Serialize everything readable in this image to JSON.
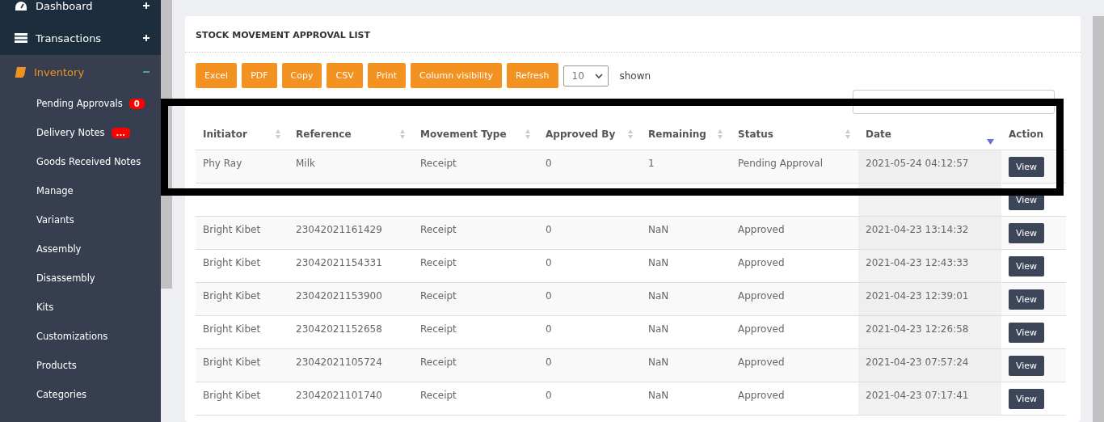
{
  "sidebar": {
    "items": [
      {
        "label": "Dashboard",
        "expanded": false,
        "selected": false
      },
      {
        "label": "Transactions",
        "expanded": false,
        "selected": false
      },
      {
        "label": "Inventory",
        "expanded": true,
        "selected": true,
        "children": [
          {
            "label": "Pending Approvals",
            "badge": "0"
          },
          {
            "label": "Delivery Notes",
            "badge": "..."
          },
          {
            "label": "Goods Received Notes"
          },
          {
            "label": "Manage"
          },
          {
            "label": "Variants"
          },
          {
            "label": "Assembly"
          },
          {
            "label": "Disassembly"
          },
          {
            "label": "Kits"
          },
          {
            "label": "Customizations"
          },
          {
            "label": "Products"
          },
          {
            "label": "Categories"
          }
        ]
      }
    ]
  },
  "card": {
    "title": "STOCK MOVEMENT APPROVAL LIST",
    "buttons": [
      "Excel",
      "PDF",
      "Copy",
      "CSV",
      "Print",
      "Column visibility",
      "Refresh"
    ],
    "page_size": "10",
    "page_size_suffix": "shown",
    "table": {
      "columns": [
        {
          "label": "Initiator",
          "sortable": true,
          "sorted": false
        },
        {
          "label": "Reference",
          "sortable": true,
          "sorted": false
        },
        {
          "label": "Movement Type",
          "sortable": true,
          "sorted": false
        },
        {
          "label": "Approved By",
          "sortable": true,
          "sorted": false
        },
        {
          "label": "Remaining",
          "sortable": true,
          "sorted": false
        },
        {
          "label": "Status",
          "sortable": true,
          "sorted": false
        },
        {
          "label": "Date",
          "sortable": true,
          "sorted": true
        },
        {
          "label": "Action",
          "sortable": false
        }
      ],
      "rows": [
        {
          "cells": [
            "Phy Ray",
            "Milk",
            "Receipt",
            "0",
            "1",
            "Pending Approval",
            "2021-05-24 04:12:57"
          ],
          "action": "View"
        },
        {
          "action": "View"
        },
        {
          "cells": [
            "Bright Kibet",
            "23042021161429",
            "Receipt",
            "0",
            "NaN",
            "Approved",
            "2021-04-23 13:14:32"
          ],
          "action": "View"
        },
        {
          "cells": [
            "Bright Kibet",
            "23042021154331",
            "Receipt",
            "0",
            "NaN",
            "Approved",
            "2021-04-23 12:43:33"
          ],
          "action": "View"
        },
        {
          "cells": [
            "Bright Kibet",
            "23042021153900",
            "Receipt",
            "0",
            "NaN",
            "Approved",
            "2021-04-23 12:39:01"
          ],
          "action": "View"
        },
        {
          "cells": [
            "Bright Kibet",
            "23042021152658",
            "Receipt",
            "0",
            "NaN",
            "Approved",
            "2021-04-23 12:26:58"
          ],
          "action": "View"
        },
        {
          "cells": [
            "Bright Kibet",
            "23042021105724",
            "Receipt",
            "0",
            "NaN",
            "Approved",
            "2021-04-23 07:57:24"
          ],
          "action": "View"
        },
        {
          "cells": [
            "Bright Kibet",
            "23042021101740",
            "Receipt",
            "0",
            "NaN",
            "Approved",
            "2021-04-23 07:17:41"
          ],
          "action": "View"
        }
      ]
    }
  }
}
